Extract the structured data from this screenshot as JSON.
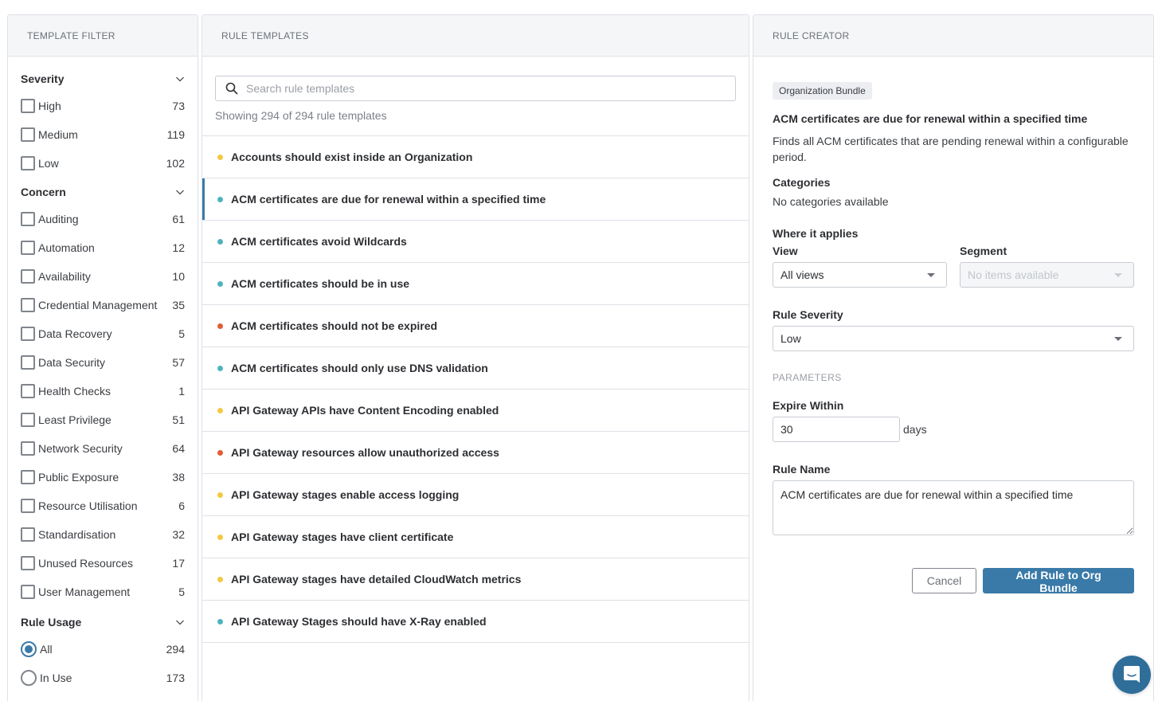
{
  "filter": {
    "header": "TEMPLATE FILTER",
    "groups": [
      {
        "title": "Severity",
        "type": "checkbox",
        "items": [
          {
            "label": "High",
            "count": "73"
          },
          {
            "label": "Medium",
            "count": "119"
          },
          {
            "label": "Low",
            "count": "102"
          }
        ]
      },
      {
        "title": "Concern",
        "type": "checkbox",
        "items": [
          {
            "label": "Auditing",
            "count": "61"
          },
          {
            "label": "Automation",
            "count": "12"
          },
          {
            "label": "Availability",
            "count": "10"
          },
          {
            "label": "Credential Management",
            "count": "35"
          },
          {
            "label": "Data Recovery",
            "count": "5"
          },
          {
            "label": "Data Security",
            "count": "57"
          },
          {
            "label": "Health Checks",
            "count": "1"
          },
          {
            "label": "Least Privilege",
            "count": "51"
          },
          {
            "label": "Network Security",
            "count": "64"
          },
          {
            "label": "Public Exposure",
            "count": "38"
          },
          {
            "label": "Resource Utilisation",
            "count": "6"
          },
          {
            "label": "Standardisation",
            "count": "32"
          },
          {
            "label": "Unused Resources",
            "count": "17"
          },
          {
            "label": "User Management",
            "count": "5"
          }
        ]
      },
      {
        "title": "Rule Usage",
        "type": "radio",
        "items": [
          {
            "label": "All",
            "count": "294",
            "checked": true
          },
          {
            "label": "In Use",
            "count": "173",
            "checked": false
          }
        ]
      }
    ]
  },
  "templates": {
    "header": "RULE TEMPLATES",
    "search_placeholder": "Search rule templates",
    "search_value": "",
    "showing_text": "Showing 294 of 294 rule templates",
    "severity_colors": {
      "high": "#e05d36",
      "medium": "#f5c842",
      "low": "#4fb3bf"
    },
    "items": [
      {
        "title": "Accounts should exist inside an Organization",
        "severity": "medium",
        "selected": false
      },
      {
        "title": "ACM certificates are due for renewal within a specified time",
        "severity": "low",
        "selected": true
      },
      {
        "title": "ACM certificates avoid Wildcards",
        "severity": "low",
        "selected": false
      },
      {
        "title": "ACM certificates should be in use",
        "severity": "low",
        "selected": false
      },
      {
        "title": "ACM certificates should not be expired",
        "severity": "high",
        "selected": false
      },
      {
        "title": "ACM certificates should only use DNS validation",
        "severity": "low",
        "selected": false
      },
      {
        "title": "API Gateway APIs have Content Encoding enabled",
        "severity": "medium",
        "selected": false
      },
      {
        "title": "API Gateway resources allow unauthorized access",
        "severity": "high",
        "selected": false
      },
      {
        "title": "API Gateway stages enable access logging",
        "severity": "medium",
        "selected": false
      },
      {
        "title": "API Gateway stages have client certificate",
        "severity": "medium",
        "selected": false
      },
      {
        "title": "API Gateway stages have detailed CloudWatch metrics",
        "severity": "medium",
        "selected": false
      },
      {
        "title": "API Gateway Stages should have X-Ray enabled",
        "severity": "low",
        "selected": false
      }
    ]
  },
  "creator": {
    "header": "RULE CREATOR",
    "badge": "Organization Bundle",
    "title": "ACM certificates are due for renewal within a specified time",
    "description": "Finds all ACM certificates that are pending renewal within a configurable period.",
    "categories_label": "Categories",
    "categories_value": "No categories available",
    "where_label": "Where it applies",
    "view_label": "View",
    "view_value": "All views",
    "segment_label": "Segment",
    "segment_value": "No items available",
    "severity_label": "Rule Severity",
    "severity_value": "Low",
    "params_header": "PARAMETERS",
    "expire_label": "Expire Within",
    "expire_value": "30",
    "expire_unit": "days",
    "rule_name_label": "Rule Name",
    "rule_name_value": "ACM certificates are due for renewal within a specified time",
    "cancel_label": "Cancel",
    "submit_label": "Add Rule to Org Bundle"
  },
  "chat": {
    "icon": "chat-icon"
  }
}
